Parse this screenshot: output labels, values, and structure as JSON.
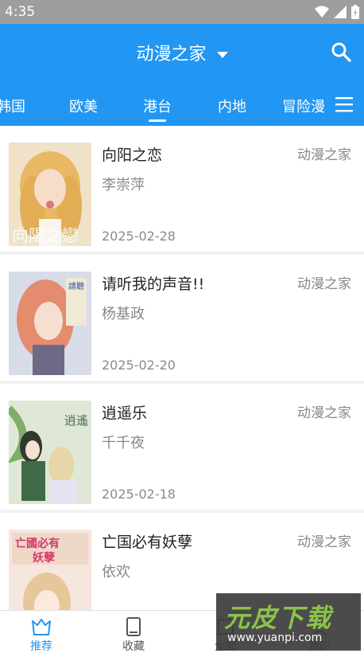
{
  "status_bar": {
    "time": "4:35"
  },
  "app_bar": {
    "title": "动漫之家",
    "tabs": [
      "韩国",
      "欧美",
      "港台",
      "内地",
      "冒险漫"
    ],
    "active_tab": "港台"
  },
  "comics": [
    {
      "title": "向阳之恋",
      "author": "李崇萍",
      "date": "2025-02-28",
      "source": "动漫之家",
      "cover_text": "向陽之戀"
    },
    {
      "title": "请听我的声音!!",
      "author": "杨基政",
      "date": "2025-02-20",
      "source": "动漫之家",
      "cover_text": "請聽我的聲音"
    },
    {
      "title": "逍遥乐",
      "author": "千千夜",
      "date": "2025-02-18",
      "source": "动漫之家",
      "cover_text": "逍遙樂"
    },
    {
      "title": "亡国必有妖孽",
      "author": "依欢",
      "date": "",
      "source": "动漫之家",
      "cover_text": "亡國必有妖孽"
    }
  ],
  "bottom_nav": [
    {
      "label": "推荐",
      "icon": "crown-icon",
      "active": true
    },
    {
      "label": "收藏",
      "icon": "book-icon",
      "active": false
    },
    {
      "label": "全部",
      "icon": "grid-icon",
      "active": false
    },
    {
      "label": "我的",
      "icon": "user-icon",
      "active": false
    }
  ],
  "watermark": {
    "brand": "元皮下载",
    "url": "www.yuanpi.com"
  },
  "colors": {
    "primary": "#2196f3",
    "status_bar": "#9e9e9e"
  }
}
